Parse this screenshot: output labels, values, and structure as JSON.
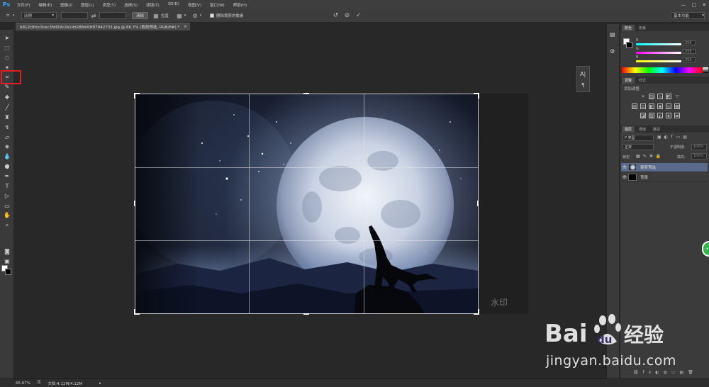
{
  "app": {
    "logo": "Ps",
    "menu": [
      "文件(F)",
      "编辑(E)",
      "图像(I)",
      "图层(L)",
      "类型(Y)",
      "选择(S)",
      "滤镜(T)",
      "3D(D)",
      "视图(V)",
      "窗口(W)",
      "帮助(H)"
    ],
    "window_controls": [
      "—",
      "□",
      "✕"
    ]
  },
  "options": {
    "ratio_select": "比例",
    "clear_button": "清除",
    "straighten_label": "拉直",
    "delete_cropped_label": "删除裁剪的像素",
    "workspace": "基本功能"
  },
  "document": {
    "tab_title": "b812c8fcc3cec3fdf29c2b1dd288d43f87942733.jpg @ 66.7% (裁剪预选, RGB/8#) *",
    "tab_close": "×",
    "watermark_text": "水印"
  },
  "panels": {
    "color_tabs": [
      "颜色",
      "色板"
    ],
    "color_channels": [
      {
        "label": "R",
        "value": "255",
        "gradient": "linear-gradient(90deg,#00ffff,#ffffff)"
      },
      {
        "label": "G",
        "value": "255",
        "gradient": "linear-gradient(90deg,#ff00ff,#ffffff)"
      },
      {
        "label": "B",
        "value": "255",
        "gradient": "linear-gradient(90deg,#ffff00,#ffffff)"
      }
    ],
    "adjust_tabs": [
      "调整",
      "样式"
    ],
    "adjust_title": "添加调整",
    "layers_tabs": [
      "图层",
      "通道",
      "路径"
    ],
    "kind_select": "P 类型",
    "blend_mode": "正常",
    "opacity_label": "不透明度:",
    "opacity_value": "100%",
    "lock_label": "锁定:",
    "fill_label": "填充:",
    "fill_value": "100%",
    "layers": [
      {
        "name": "裁剪预选",
        "selected": true
      },
      {
        "name": "背景",
        "selected": false
      }
    ]
  },
  "status": {
    "zoom": "66.67%",
    "doc_info": "文档:4.12M/4.12M"
  },
  "watermark": {
    "baidu_text": "Bai",
    "baidu_text2": "du",
    "jingyan": "经验",
    "url": "jingyan.baidu.com"
  },
  "float_badge": "+A"
}
